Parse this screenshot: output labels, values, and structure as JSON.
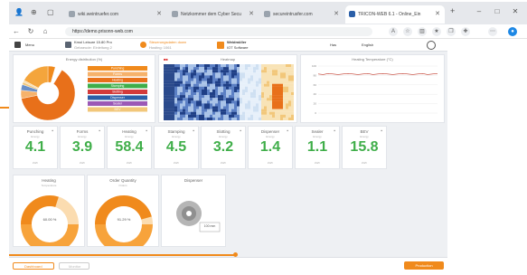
{
  "browser": {
    "tabs": [
      {
        "label": "wiki.weintruefer.com",
        "active": false
      },
      {
        "label": "Netzkommer dem Cyber Secu",
        "active": false
      },
      {
        "label": "secureintrusfer.com",
        "active": false
      },
      {
        "label": "TRICON-WEB 6.1 - Online_Ein",
        "active": true
      }
    ],
    "new_tab": "+",
    "url": "https://demo.prisonn-web.com",
    "window_controls": [
      "–",
      "□",
      "✕"
    ]
  },
  "app": {
    "header": {
      "menu_label": "Menu",
      "device_line1": "Kmol Leisure 15.80 Pro",
      "device_line2": "Gebaeude: Einleitung 2",
      "alert_line1": "Steuerungsdaten down",
      "alert_line2": "Hosting: 1061",
      "brand_line1": "Weidmüller",
      "brand_line2": "IOT Software",
      "lang1": "Has",
      "lang2": "English",
      "colors": {
        "accent": "#f08a1c",
        "green": "#3fae49"
      }
    },
    "panels": {
      "distribution_title": "Energy distribution (%)",
      "heatmap_title": "Heatmap",
      "temperature_title": "Heating Temperature (°C)"
    },
    "kpis": [
      {
        "name": "Punching",
        "sub": "Energy",
        "value": "4.1",
        "unit": "kWh"
      },
      {
        "name": "Forms",
        "sub": "Energy",
        "value": "3.9",
        "unit": "kWh"
      },
      {
        "name": "Heating",
        "sub": "Energy",
        "value": "58.4",
        "unit": "kWh"
      },
      {
        "name": "Stamping",
        "sub": "Energy",
        "value": "4.5",
        "unit": "kWh"
      },
      {
        "name": "Slotting",
        "sub": "Energy",
        "value": "3.2",
        "unit": "kWh"
      },
      {
        "name": "Dispenser",
        "sub": "Energy",
        "value": "1.4",
        "unit": "kWh"
      },
      {
        "name": "Sealer",
        "sub": "Energy",
        "value": "1.1",
        "unit": "kWh"
      },
      {
        "name": "BEV",
        "sub": "Energy",
        "value": "15.8",
        "unit": "kWh"
      }
    ],
    "gauges": [
      {
        "title": "Heating",
        "sub": "Temperature",
        "value_label": "60.00 %",
        "fraction": 0.6
      },
      {
        "title": "Order Quantity",
        "sub": "Orders",
        "value_label": "91.29 %",
        "fraction": 0.9129
      },
      {
        "title": "Dispenser",
        "sub": "",
        "value_label": "100 mm",
        "fraction": 1.0
      }
    ],
    "footer": {
      "dashboard_label": "Dashboard",
      "second_label": "Monitor",
      "right_button": "Production"
    }
  },
  "chart_data": [
    {
      "type": "pie",
      "title": "Energy distribution (%)",
      "legend": [
        "Punching",
        "Forms",
        "Heating",
        "Stamping",
        "Slotting",
        "Dispenser",
        "Sealer",
        "BEV"
      ],
      "values": [
        4.1,
        3.9,
        58.4,
        4.5,
        3.2,
        1.4,
        1.1,
        15.8
      ],
      "colors": [
        "#f08a1c",
        "#ffffff",
        "#e8701a",
        "#f6b26b",
        "#6a8fc7",
        "#f2c77a",
        "#f9dcaa",
        "#f4a53c"
      ]
    },
    {
      "type": "heatmap",
      "title": "Heatmap"
    },
    {
      "type": "line",
      "title": "Heating Temperature (°C)",
      "ylim": [
        0,
        100
      ],
      "series": [
        {
          "values": [
            83,
            82,
            84,
            83,
            82,
            83,
            84,
            83,
            82,
            83,
            84,
            82,
            83,
            84,
            83,
            82,
            83,
            84,
            83,
            82,
            83,
            84,
            82,
            83,
            84
          ]
        }
      ]
    }
  ]
}
